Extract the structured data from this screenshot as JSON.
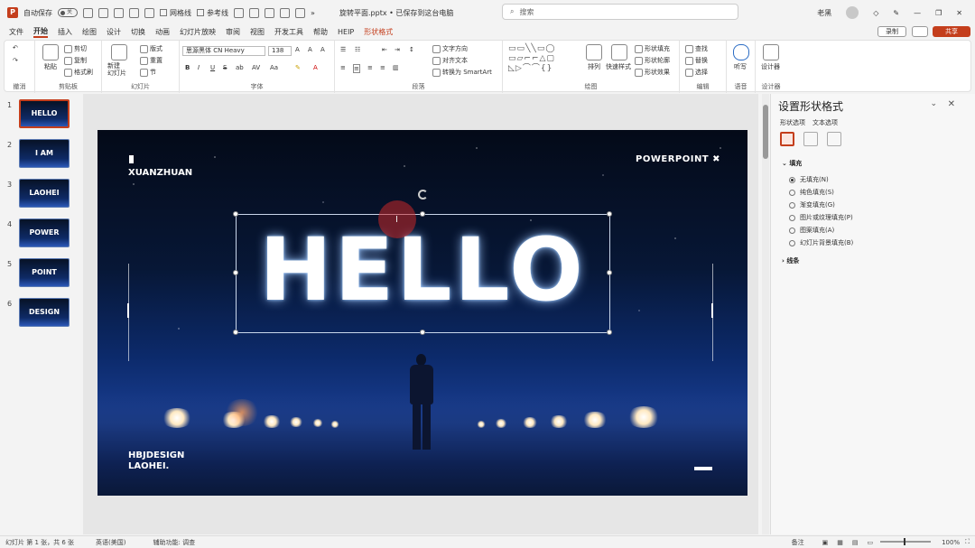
{
  "titlebar": {
    "autosave_label": "自动保存",
    "autosave_state": "关",
    "checkbox_gridlines": "网格线",
    "checkbox_guides": "参考线",
    "more": "»",
    "doc_title": "旋转平面.pptx • 已保存到这台电脑",
    "search_placeholder": "搜索",
    "user_name": "老黑"
  },
  "tabs": [
    "文件",
    "开始",
    "插入",
    "绘图",
    "设计",
    "切换",
    "动画",
    "幻灯片放映",
    "审阅",
    "视图",
    "开发工具",
    "帮助",
    "HEIP",
    "形状格式"
  ],
  "active_tab": "开始",
  "actions": {
    "record": "录制",
    "share": "共享"
  },
  "ribbon": {
    "undo": {
      "label": "撤消"
    },
    "clipboard": {
      "label": "剪贴板",
      "paste": "粘贴",
      "cut": "剪切",
      "copy": "复制",
      "format_painter": "格式刷"
    },
    "slides": {
      "label": "幻灯片",
      "new_slide": "新建\n幻灯片",
      "layout": "版式",
      "reset": "重置",
      "section": "节"
    },
    "font": {
      "label": "字体",
      "font_name": "思源黑体 CN Heavy",
      "font_size": "138",
      "bold": "B",
      "italic": "I",
      "underline": "U",
      "strike": "S",
      "shadow": "ab",
      "spacing": "AV",
      "case": "Aa",
      "grow": "A",
      "shrink": "A",
      "clear": "A",
      "font_color": "A"
    },
    "paragraph": {
      "label": "段落",
      "text_direction": "文字方向",
      "align_text": "对齐文本",
      "smartart": "转换为 SmartArt"
    },
    "drawing": {
      "label": "绘图",
      "arrange": "排列",
      "quick_styles": "快速样式",
      "shape_fill": "形状填充",
      "shape_outline": "形状轮廓",
      "shape_effects": "形状效果"
    },
    "editing": {
      "label": "编辑",
      "find": "查找",
      "replace": "替换",
      "select": "选择"
    },
    "voice": {
      "label": "语音",
      "dictate": "听写"
    },
    "designer": {
      "label": "设计器",
      "designer": "设计器"
    }
  },
  "thumbnails": [
    {
      "num": "1",
      "text": "HELLO"
    },
    {
      "num": "2",
      "text": "I AM"
    },
    {
      "num": "3",
      "text": "LAOHEI"
    },
    {
      "num": "4",
      "text": "POWER"
    },
    {
      "num": "5",
      "text": "POINT"
    },
    {
      "num": "6",
      "text": "DESIGN"
    }
  ],
  "slide": {
    "top_left": "XUANZHUAN",
    "top_right": "POWERPOINT ✖",
    "headline": "HELLO",
    "bottom_left_1": "HBJDESIGN",
    "bottom_left_2": "LAOHEI."
  },
  "format_pane": {
    "title": "设置形状格式",
    "tab_shape": "形状选项",
    "tab_text": "文本选项",
    "fill_section": "填充",
    "fill_options": [
      {
        "label": "无填充(N)",
        "selected": true
      },
      {
        "label": "纯色填充(S)",
        "selected": false
      },
      {
        "label": "渐变填充(G)",
        "selected": false
      },
      {
        "label": "图片或纹理填充(P)",
        "selected": false
      },
      {
        "label": "图案填充(A)",
        "selected": false
      },
      {
        "label": "幻灯片背景填充(B)",
        "selected": false
      }
    ],
    "line_section": "线条"
  },
  "status": {
    "slide_info": "幻灯片 第 1 张，共 6 张",
    "language": "英语(美国)",
    "accessibility": "辅助功能: 调查",
    "notes": "备注",
    "zoom": "100%"
  },
  "colors": {
    "accent": "#c43e1c",
    "slide_bg": "#0c2a6b"
  }
}
